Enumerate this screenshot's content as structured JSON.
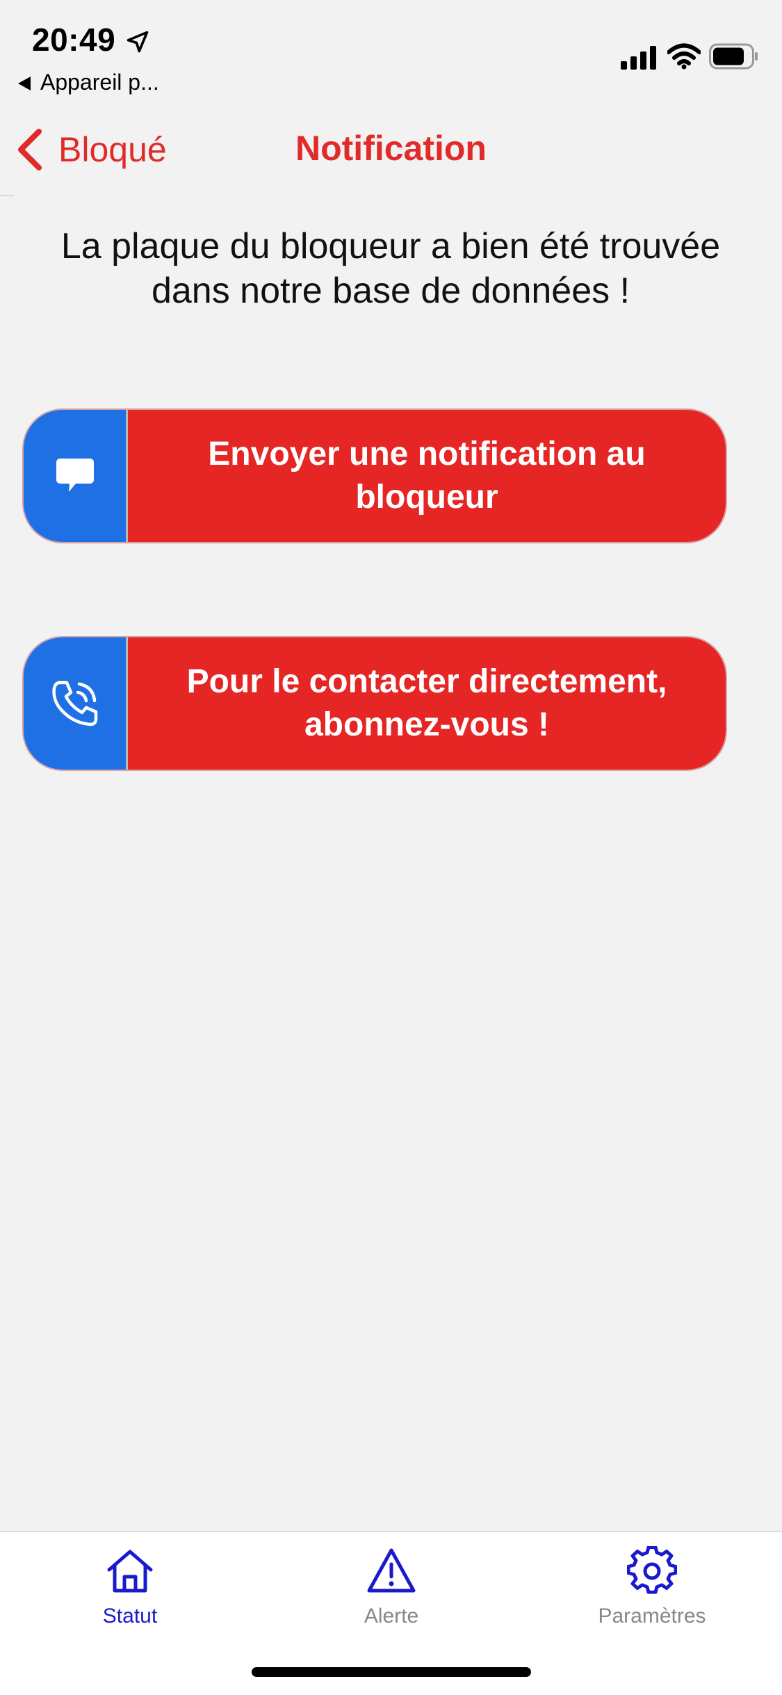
{
  "status_bar": {
    "time": "20:49",
    "back_app_label": "Appareil p...",
    "icons": [
      "location-arrow-icon",
      "cellular-signal-icon",
      "wifi-icon",
      "battery-icon"
    ]
  },
  "nav": {
    "back_label": "Bloqué",
    "title": "Notification"
  },
  "message": "La plaque du bloqueur a bien été trouvée dans notre base de données !",
  "actions": [
    {
      "label": "Envoyer une notification au bloqueur",
      "icon": "chat-bubble-icon"
    },
    {
      "label": "Pour le contacter directement, abonnez-vous !",
      "icon": "phone-ringing-icon"
    }
  ],
  "tabs": [
    {
      "label": "Statut",
      "icon": "home-icon",
      "active": true
    },
    {
      "label": "Alerte",
      "icon": "warning-icon",
      "active": false
    },
    {
      "label": "Paramètres",
      "icon": "gear-icon",
      "active": false
    }
  ],
  "colors": {
    "accent_red": "#e62525",
    "nav_red": "#e12a2a",
    "icon_blue": "#1f6fe5",
    "tab_active": "#1a1acc",
    "tab_inactive": "#888888",
    "background": "#f2f2f2"
  }
}
